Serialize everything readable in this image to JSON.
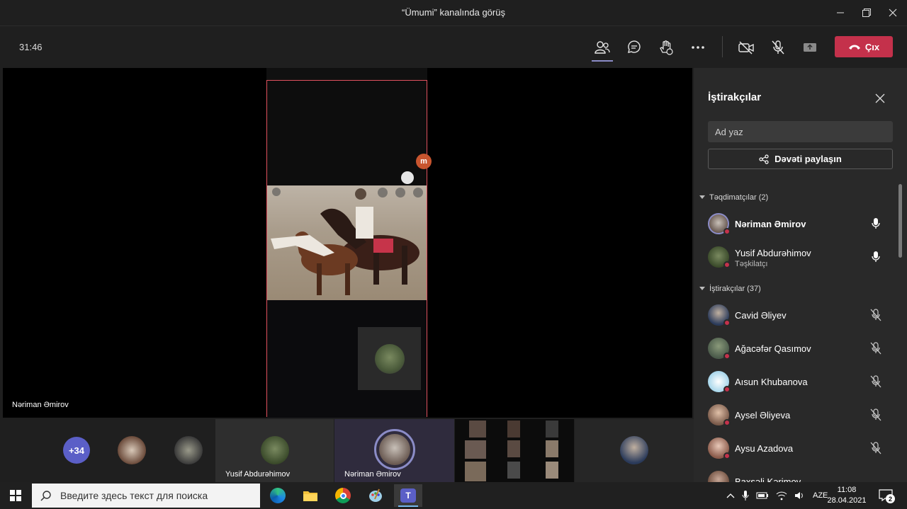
{
  "window": {
    "title": "“Ümumi” kanalında görüş"
  },
  "toolbar": {
    "timer": "31:46",
    "leave_label": "Çıx"
  },
  "stage": {
    "speaker_name": "Nəriman Əmirov"
  },
  "strip": {
    "more_count": "+34",
    "tiles": [
      {
        "name": "Yusif Abdurəhimov"
      },
      {
        "name": "Nəriman Əmirov"
      }
    ]
  },
  "panel": {
    "title": "İştirakçılar",
    "search_placeholder": "Ad yaz",
    "invite_label": "Dəvəti paylaşın",
    "presenters_header": "Təqdimatçılar (2)",
    "attendees_header": "İştirakçılar (37)",
    "presenters": [
      {
        "name": "Nəriman Əmirov",
        "subtitle": ""
      },
      {
        "name": "Yusif Abdurəhimov",
        "subtitle": "Təşkilatçı"
      }
    ],
    "attendees": [
      {
        "name": "Cavid Əliyev"
      },
      {
        "name": "Ağacəfər Qasımov"
      },
      {
        "name": "Aısun Khubanova"
      },
      {
        "name": "Aysel Əliyeva"
      },
      {
        "name": "Aysu Azadova"
      },
      {
        "name": "Baxşəli Kərimov"
      }
    ]
  },
  "taskbar": {
    "search_placeholder": "Введите здесь текст для поиска",
    "language": "AZE",
    "time": "11:08",
    "date": "28.04.2021",
    "notifications": "2"
  },
  "colors": {
    "accent": "#5b5fc7",
    "leave": "#c4314b",
    "share_border": "#e0525e"
  }
}
